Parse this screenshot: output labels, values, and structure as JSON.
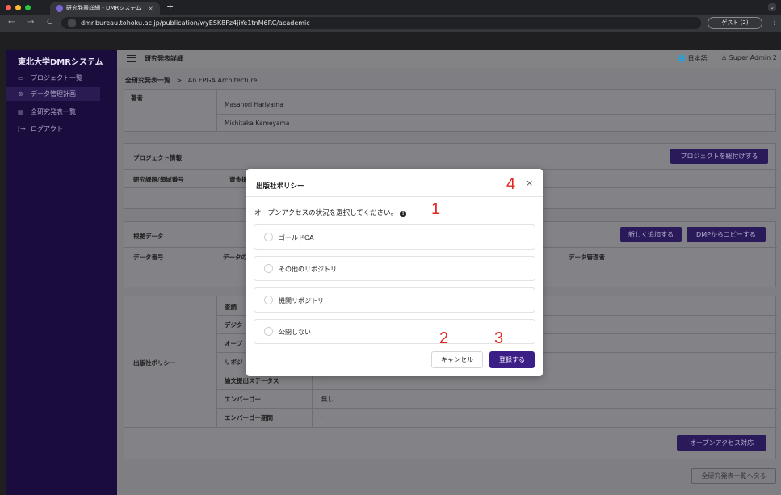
{
  "browser": {
    "tab_title": "研究発表詳細 - DMRシステム",
    "tab_close": "×",
    "new_tab": "+",
    "url": "dmr.bureau.tohoku.ac.jp/publication/wyESK8Fz4jiYe1tnM6RC/academic",
    "guest_label": "ゲスト (2)",
    "menu_icon": "⋮",
    "back": "←",
    "forward": "→",
    "reload": "C",
    "tab_menu": "⌄"
  },
  "sidebar": {
    "brand": "東北大学DMRシステム",
    "items": [
      {
        "label": "プロジェクト一覧",
        "icon": "▭"
      },
      {
        "label": "データ管理計画",
        "icon": "⊜"
      },
      {
        "label": "全研究発表一覧",
        "icon": "▤"
      },
      {
        "label": "ログアウト",
        "icon": "[→"
      }
    ]
  },
  "header": {
    "title": "研究発表詳細",
    "language": "日本語",
    "user": "Super Admin 2"
  },
  "breadcrumb": {
    "root": "全研究発表一覧",
    "separator": ">",
    "current": "An FPGA Architecture..."
  },
  "authors": {
    "label": "著者",
    "rows": [
      "Masanori Hariyama",
      "Michitaka Kameyama"
    ]
  },
  "project": {
    "title": "プロジェクト情報",
    "link_button": "プロジェクトを紐付けする",
    "col1": "研究課題/領域番号",
    "col2": "資金提"
  },
  "evidence": {
    "title": "根拠データ",
    "add_button": "新しく追加する",
    "copy_button": "DMPからコピーする",
    "col1": "データ番号",
    "col2": "データの",
    "col3": "データ管理者"
  },
  "policy": {
    "label": "出版社ポリシー",
    "rows": [
      {
        "key": "査読",
        "value": ""
      },
      {
        "key": "デジタ",
        "value": ""
      },
      {
        "key": "オープ",
        "value": ""
      },
      {
        "key": "リポジ",
        "value": ""
      },
      {
        "key": "論文提出ステータス",
        "value": "-"
      },
      {
        "key": "エンバーゴー",
        "value": "無し"
      },
      {
        "key": "エンバーゴー期間",
        "value": "-"
      }
    ],
    "oa_button": "オープンアクセス対応"
  },
  "back_button": "全研究発表一覧へ戻る",
  "modal": {
    "title": "出版社ポリシー",
    "close": "×",
    "prompt": "オープンアクセスの状況を選択してください。",
    "info": "!",
    "options": [
      "ゴールドOA",
      "その他のリポジトリ",
      "機関リポジトリ",
      "公開しない"
    ],
    "cancel": "キャンセル",
    "submit": "登録する"
  },
  "markers": [
    "1",
    "2",
    "3",
    "4"
  ],
  "colors": {
    "sidebar_bg": "#1b0c3e",
    "primary": "#3b1f86",
    "marker": "#e1281f"
  }
}
